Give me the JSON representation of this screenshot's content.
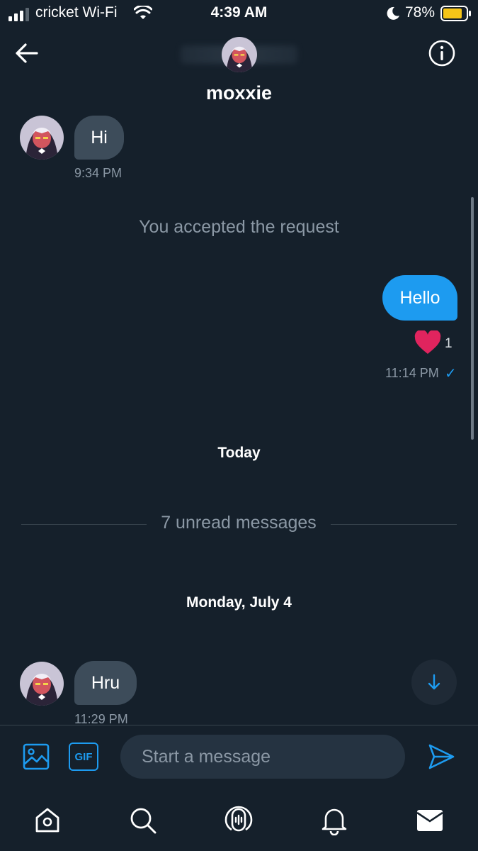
{
  "status_bar": {
    "carrier": "cricket Wi-Fi",
    "time": "4:39 AM",
    "battery": "78%"
  },
  "header": {
    "title": "moxxie",
    "back_icon": "arrow-left-icon",
    "info_icon": "info-circle-icon"
  },
  "messages": {
    "first": {
      "text": "Hi",
      "time": "9:34 PM"
    },
    "system_notice": "You accepted the request",
    "sent": {
      "text": "Hello",
      "reaction_count": "1",
      "time": "11:14 PM",
      "read_mark": "✓"
    },
    "today_label": "Today",
    "unread_label": "7 unread messages",
    "date_label": "Monday, July 4",
    "last": {
      "text": "Hru",
      "time": "11:29 PM"
    }
  },
  "composer": {
    "placeholder": "Start a message",
    "gif_label": "GIF"
  },
  "colors": {
    "background": "#15202b",
    "accent": "#1d9bf0",
    "incoming_bubble": "#3d4c5a",
    "heart": "#e0245e"
  }
}
